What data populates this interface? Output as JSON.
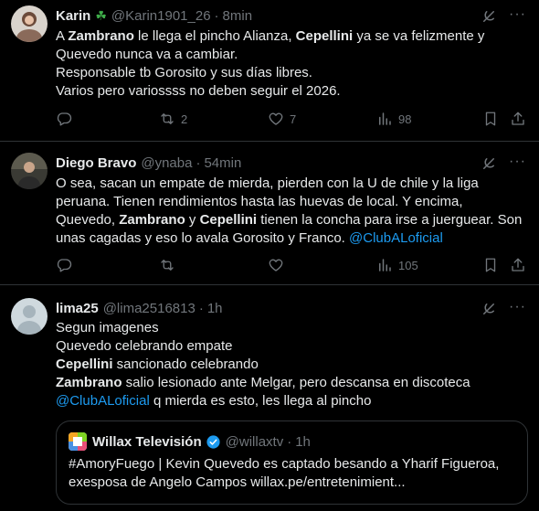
{
  "tweets": [
    {
      "display_name": "Karin",
      "name_emoji": "☘",
      "handle": "@Karin1901_26",
      "time": "8min",
      "lines": [
        [
          {
            "t": "A "
          },
          {
            "t": "Zambrano",
            "b": true
          },
          {
            "t": " le llega el pincho Alianza, "
          },
          {
            "t": "Cepellini",
            "b": true
          },
          {
            "t": " ya se va felizmente y"
          }
        ],
        [
          {
            "t": "Quevedo nunca va a cambiar."
          }
        ],
        [
          {
            "t": "Responsable tb Gorosito y sus días libres."
          }
        ],
        [
          {
            "t": "Varios pero variossss no deben seguir el 2026."
          }
        ]
      ],
      "replies": "",
      "reposts": "2",
      "likes": "7",
      "views": "98"
    },
    {
      "display_name": "Diego Bravo",
      "handle": "@ynaba",
      "time": "54min",
      "lines": [
        [
          {
            "t": "O sea, sacan un empate de mierda, pierden con la U de chile y la liga"
          }
        ],
        [
          {
            "t": "peruana. Tienen rendimientos hasta las huevas de local. Y encima,"
          }
        ],
        [
          {
            "t": "Quevedo, "
          },
          {
            "t": "Zambrano",
            "b": true
          },
          {
            "t": " y "
          },
          {
            "t": "Cepellini",
            "b": true
          },
          {
            "t": " tienen la concha para irse a juerguear. Son"
          }
        ],
        [
          {
            "t": "unas cagadas  y eso lo avala Gorosito y Franco. "
          },
          {
            "t": "@ClubALoficial",
            "link": true
          }
        ]
      ],
      "replies": "",
      "reposts": "",
      "likes": "",
      "views": "105"
    },
    {
      "display_name": "lima25",
      "handle": "@lima2516813",
      "time": "1h",
      "lines": [
        [
          {
            "t": "Segun imagenes"
          }
        ],
        [
          {
            "t": "Quevedo celebrando empate"
          }
        ],
        [
          {
            "t": "Cepellini",
            "b": true
          },
          {
            "t": " sancionado celebrando"
          }
        ],
        [
          {
            "t": "Zambrano",
            "b": true
          },
          {
            "t": " salio lesionado ante Melgar, pero descansa en discoteca"
          }
        ],
        [
          {
            "t": "@ClubALoficial",
            "link": true
          },
          {
            "t": " q mierda es esto, les llega al pincho"
          }
        ]
      ],
      "quote": {
        "display_name": "Willax Televisión",
        "handle": "@willaxtv",
        "time": "1h",
        "verified": true,
        "lines": [
          "#AmoryFuego | Kevin Quevedo es captado besando a Yharif Figueroa,",
          "exesposa de Angelo Campos willax.pe/entretenimient..."
        ]
      }
    }
  ],
  "separator": "·",
  "more_glyph": "···",
  "icons": {
    "reply": "reply-icon",
    "repost": "repost-icon",
    "like": "heart-icon",
    "views": "views-chart-icon",
    "bookmark": "bookmark-icon",
    "share": "share-icon",
    "grok": "grok-icon",
    "verified": "verified-badge-icon"
  },
  "colors": {
    "background": "#000000",
    "text": "#e7e9ea",
    "muted": "#71767b",
    "link": "#1d9bf0",
    "border": "#2f3336"
  }
}
